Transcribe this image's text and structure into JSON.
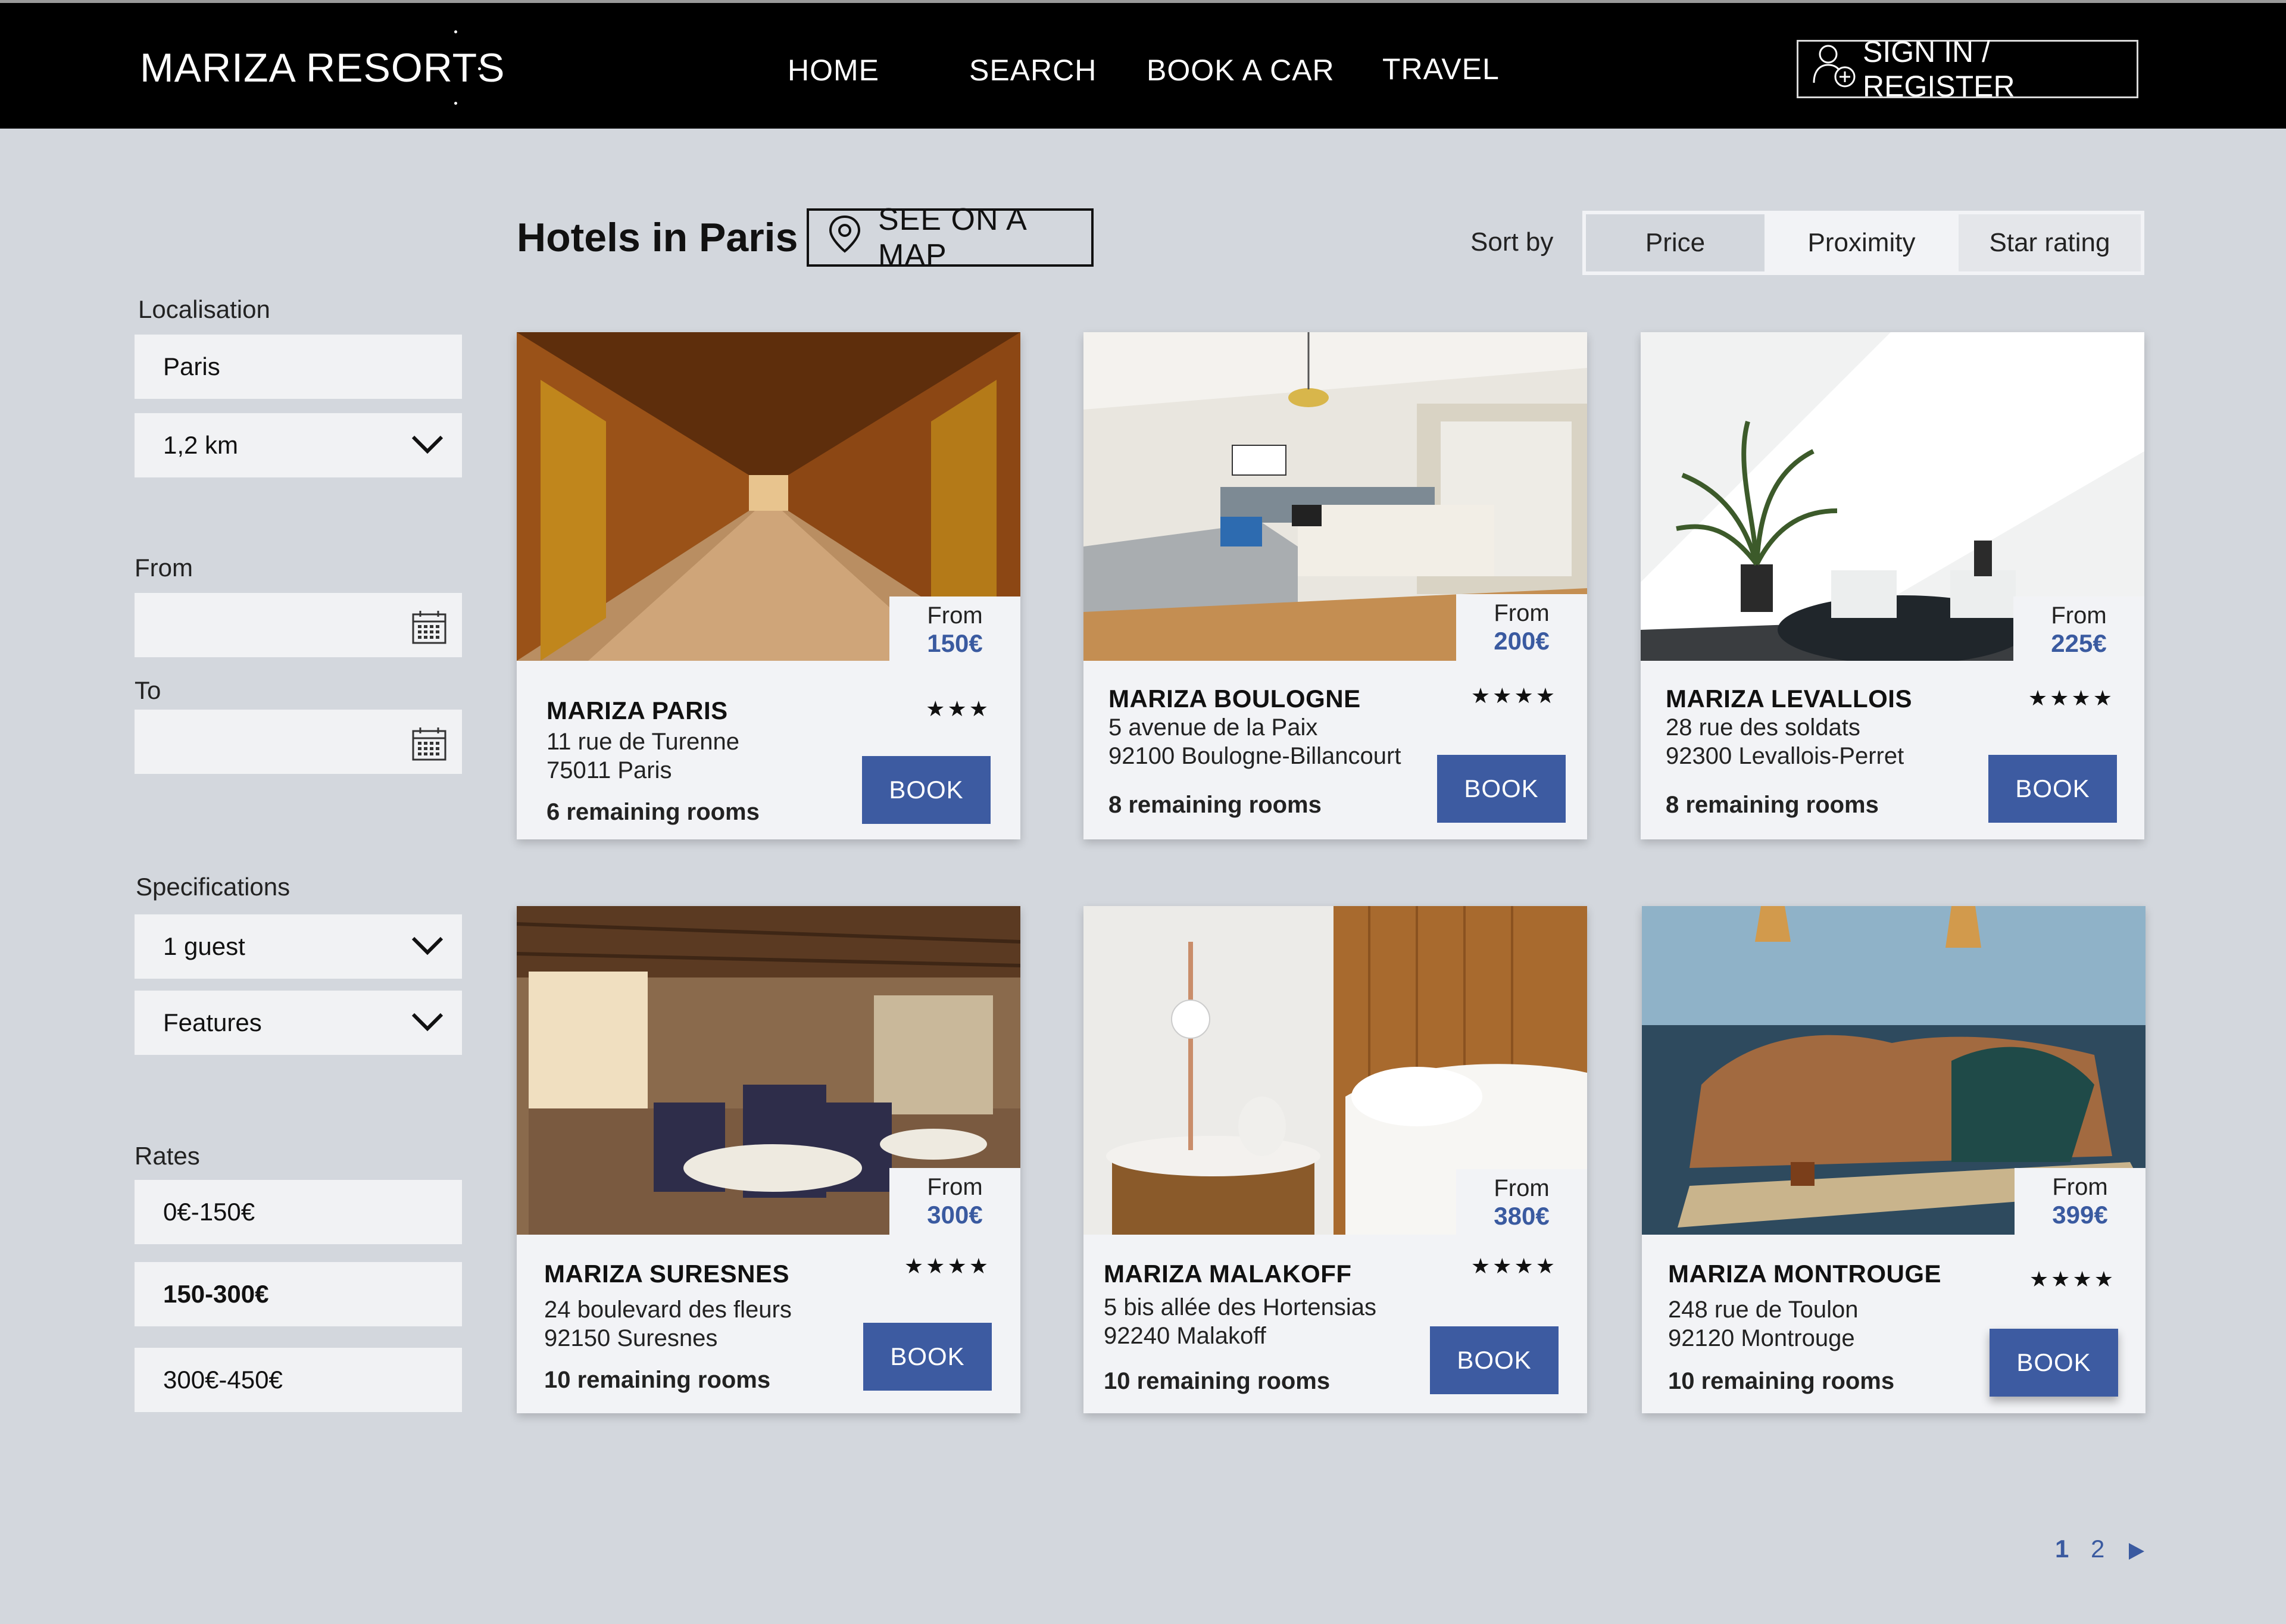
{
  "header": {
    "brand": "MARIZA RESORTS",
    "nav": [
      "HOME",
      "SEARCH",
      "BOOK A CAR",
      "TRAVEL"
    ],
    "signin": "SIGN IN / REGISTER"
  },
  "main": {
    "title": "Hotels in Paris",
    "map_button": "SEE ON A MAP",
    "sort_label": "Sort by",
    "sort_options": [
      "Price",
      "Proximity",
      "Star rating"
    ]
  },
  "sidebar": {
    "localisation_label": "Localisation",
    "city": "Paris",
    "distance": "1,2 km",
    "from_label": "From",
    "to_label": "To",
    "specs_label": "Specifications",
    "guests": "1 guest",
    "features": "Features",
    "rates_label": "Rates",
    "rates": [
      "0€-150€",
      "150-300€",
      "300€-450€"
    ]
  },
  "hotels": [
    {
      "from": "From",
      "price": "150€",
      "name": "MARIZA PARIS",
      "stars": "★★★",
      "addr1": "11 rue de Turenne",
      "addr2": "75011 Paris",
      "rooms": "6 remaining rooms",
      "book": "BOOK"
    },
    {
      "from": "From",
      "price": "200€",
      "name": "MARIZA BOULOGNE",
      "stars": "★★★★",
      "addr1": "5 avenue de la Paix",
      "addr2": "92100 Boulogne-Billancourt",
      "rooms": "8 remaining rooms",
      "book": "BOOK"
    },
    {
      "from": "From",
      "price": "225€",
      "name": "MARIZA LEVALLOIS",
      "stars": "★★★★",
      "addr1": "28 rue des soldats",
      "addr2": "92300 Levallois-Perret",
      "rooms": "8 remaining rooms",
      "book": "BOOK"
    },
    {
      "from": "From",
      "price": "300€",
      "name": "MARIZA SURESNES",
      "stars": "★★★★",
      "addr1": "24 boulevard des fleurs",
      "addr2": "92150 Suresnes",
      "rooms": "10 remaining rooms",
      "book": "BOOK"
    },
    {
      "from": "From",
      "price": "380€",
      "name": "MARIZA MALAKOFF",
      "stars": "★★★★",
      "addr1": "5 bis allée des Hortensias",
      "addr2": "92240 Malakoff",
      "rooms": "10 remaining rooms",
      "book": "BOOK"
    },
    {
      "from": "From",
      "price": "399€",
      "name": "MARIZA MONTROUGE",
      "stars": "★★★★",
      "addr1": "248 rue de Toulon",
      "addr2": "92120 Montrouge",
      "rooms": "10 remaining rooms",
      "book": "BOOK"
    }
  ],
  "pagination": {
    "current": "1",
    "next_page": "2"
  }
}
